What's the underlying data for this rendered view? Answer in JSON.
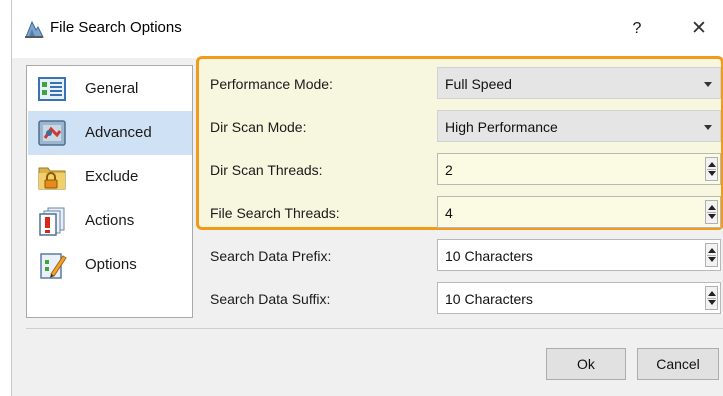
{
  "window": {
    "title": "File Search Options",
    "help_label": "?",
    "close_label": "✕",
    "app_icon": "app-icon"
  },
  "sidebar": {
    "items": [
      {
        "label": "General",
        "icon": "general-icon",
        "selected": false
      },
      {
        "label": "Advanced",
        "icon": "advanced-icon",
        "selected": true
      },
      {
        "label": "Exclude",
        "icon": "exclude-lock-icon",
        "selected": false
      },
      {
        "label": "Actions",
        "icon": "actions-icon",
        "selected": false
      },
      {
        "label": "Options",
        "icon": "options-icon",
        "selected": false
      }
    ]
  },
  "settings": {
    "performance_mode": {
      "label": "Performance Mode:",
      "value": "Full Speed"
    },
    "dir_scan_mode": {
      "label": "Dir Scan Mode:",
      "value": "High Performance"
    },
    "dir_scan_threads": {
      "label": "Dir Scan Threads:",
      "value": "2"
    },
    "file_search_threads": {
      "label": "File Search Threads:",
      "value": "4"
    },
    "search_data_prefix": {
      "label": "Search Data Prefix:",
      "value": "10 Characters"
    },
    "search_data_suffix": {
      "label": "Search Data Suffix:",
      "value": "10 Characters"
    }
  },
  "buttons": {
    "ok": "Ok",
    "cancel": "Cancel"
  },
  "colors": {
    "highlight_border": "#f19a1b",
    "highlight_fill": "#f7f6df",
    "selected_item": "#cfe2f5"
  }
}
